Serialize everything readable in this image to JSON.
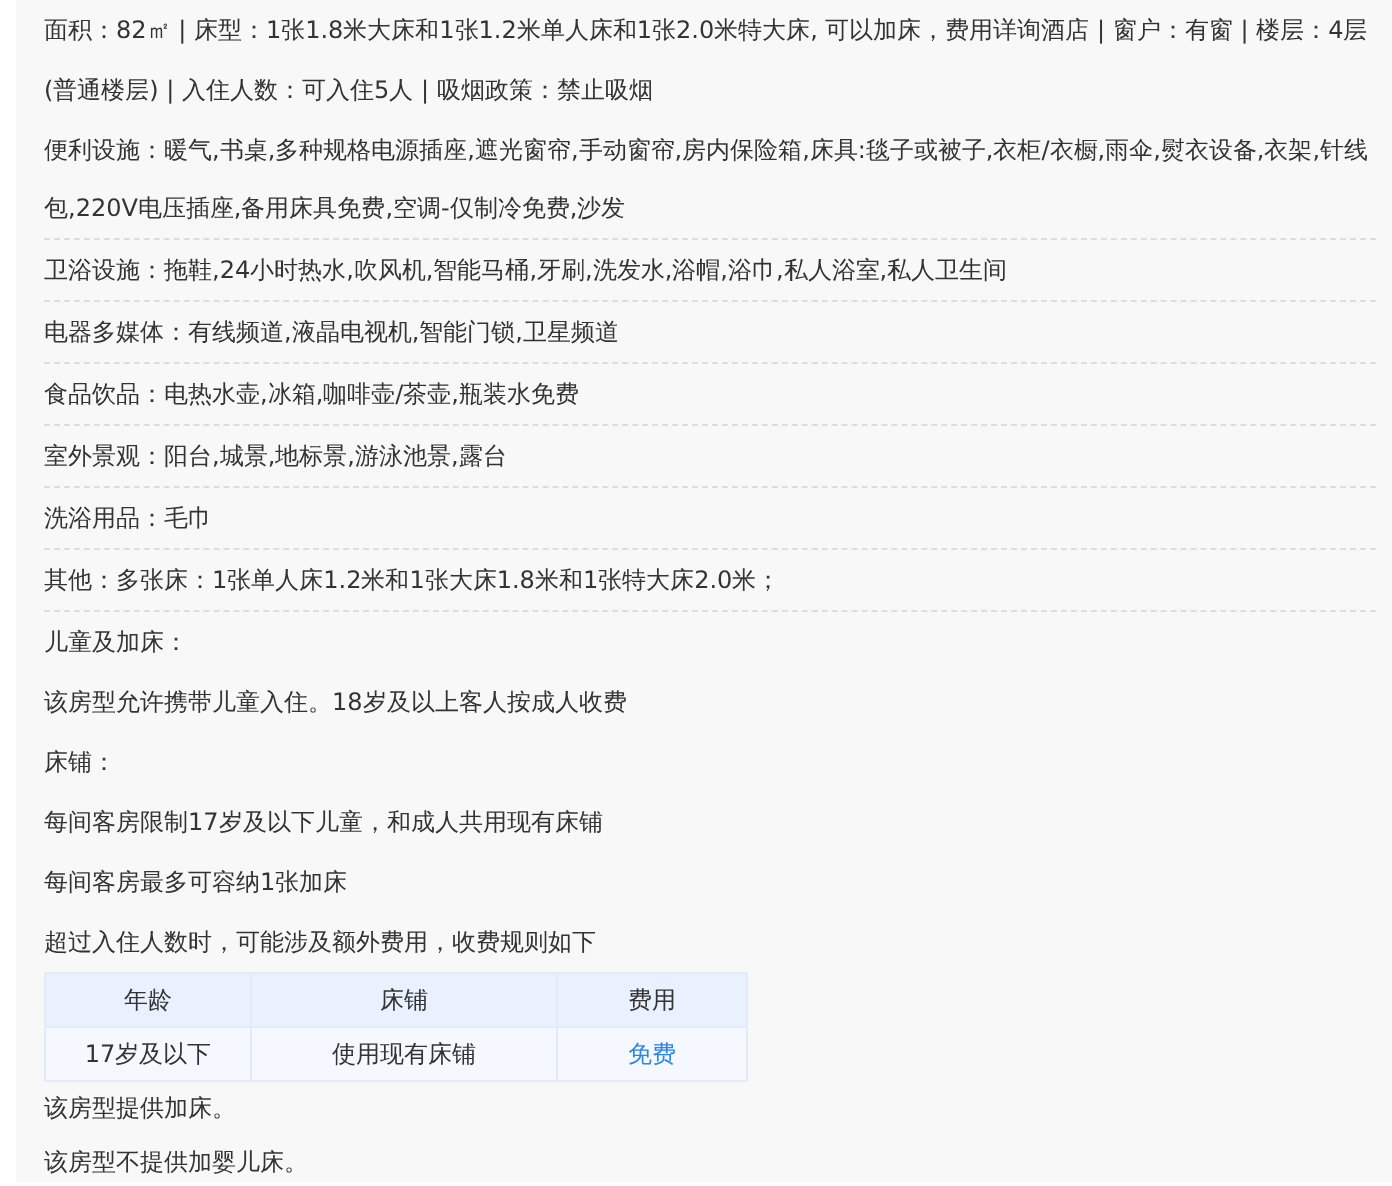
{
  "summary": "面积：82㎡ | 床型：1张1.8米大床和1张1.2米单人床和1张2.0米特大床, 可以加床，费用详询酒店 | 窗户：有窗 | 楼层：4层(普通楼层) | 入住人数：可入住5人 | 吸烟政策：禁止吸烟",
  "facilities": [
    {
      "label": "便利设施：",
      "value": "暖气,书桌,多种规格电源插座,遮光窗帘,手动窗帘,房内保险箱,床具:毯子或被子,衣柜/衣橱,雨伞,熨衣设备,衣架,针线包,220V电压插座,备用床具免费,空调-仅制冷免费,沙发"
    },
    {
      "label": "卫浴设施：",
      "value": "拖鞋,24小时热水,吹风机,智能马桶,牙刷,洗发水,浴帽,浴巾,私人浴室,私人卫生间"
    },
    {
      "label": "电器多媒体：",
      "value": "有线频道,液晶电视机,智能门锁,卫星频道"
    },
    {
      "label": "食品饮品：",
      "value": "电热水壶,冰箱,咖啡壶/茶壶,瓶装水免费"
    },
    {
      "label": "室外景观：",
      "value": "阳台,城景,地标景,游泳池景,露台"
    },
    {
      "label": "洗浴用品：",
      "value": "毛巾"
    },
    {
      "label": "其他：",
      "value": "多张床：1张单人床1.2米和1张大床1.8米和1张特大床2.0米；"
    }
  ],
  "children_policy": [
    "儿童及加床：",
    "该房型允许携带儿童入住。18岁及以上客人按成人收费",
    "床铺：",
    "每间客房限制17岁及以下儿童，和成人共用现有床铺",
    "每间客房最多可容纳1张加床",
    "超过入住人数时，可能涉及额外费用，收费规则如下"
  ],
  "fee_table": {
    "columns": [
      "年龄",
      "床铺",
      "费用"
    ],
    "rows": [
      [
        "17岁及以下",
        "使用现有床铺",
        "免费"
      ]
    ]
  },
  "notes": [
    "该房型提供加床。",
    "该房型不提供加婴儿床。"
  ]
}
